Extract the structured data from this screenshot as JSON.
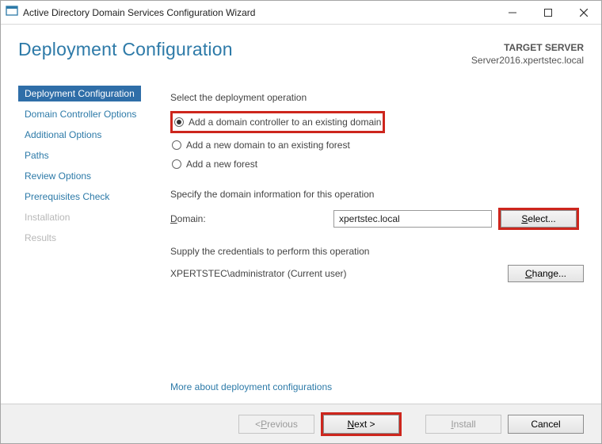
{
  "window": {
    "title": "Active Directory Domain Services Configuration Wizard"
  },
  "header": {
    "page_title": "Deployment Configuration",
    "target_label": "TARGET SERVER",
    "target_server": "Server2016.xpertstec.local"
  },
  "sidebar": {
    "items": [
      {
        "label": "Deployment Configuration",
        "state": "active"
      },
      {
        "label": "Domain Controller Options",
        "state": "normal"
      },
      {
        "label": "Additional Options",
        "state": "normal"
      },
      {
        "label": "Paths",
        "state": "normal"
      },
      {
        "label": "Review Options",
        "state": "normal"
      },
      {
        "label": "Prerequisites Check",
        "state": "normal"
      },
      {
        "label": "Installation",
        "state": "disabled"
      },
      {
        "label": "Results",
        "state": "disabled"
      }
    ]
  },
  "main": {
    "select_op_label": "Select the deployment operation",
    "radios": [
      {
        "label": "Add a domain controller to an existing domain",
        "selected": true
      },
      {
        "label": "Add a new domain to an existing forest",
        "selected": false
      },
      {
        "label": "Add a new forest",
        "selected": false
      }
    ],
    "specify_label": "Specify the domain information for this operation",
    "domain_label": "Domain:",
    "domain_value": "xpertstec.local",
    "select_btn": "Select...",
    "creds_label": "Supply the credentials to perform this operation",
    "creds_value": "XPERTSTEC\\administrator (Current user)",
    "change_btn": "Change...",
    "more_link": "More about deployment configurations"
  },
  "footer": {
    "previous": "< Previous",
    "next": "Next >",
    "install": "Install",
    "cancel": "Cancel"
  }
}
